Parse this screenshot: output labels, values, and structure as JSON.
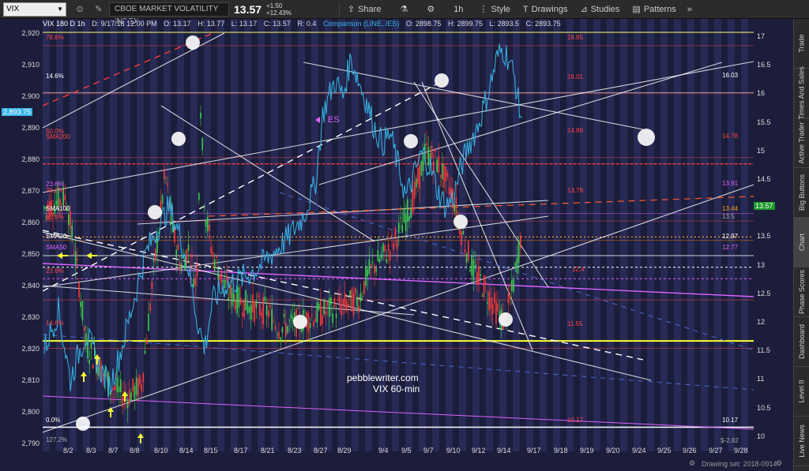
{
  "toolbar": {
    "symbol": "VIX",
    "instrument_name": "CBOE MARKET VOLATILITY INDEX",
    "last_price": "13.57",
    "change": "+1.50",
    "change_pct": "+12.43%",
    "share_label": "Share",
    "interval_label": "1h",
    "style_label": "Style",
    "drawings_label": "Drawings",
    "studies_label": "Studies",
    "patterns_label": "Patterns"
  },
  "infobar": {
    "chart_id": "VIX 180 D 1h",
    "date": "D: 9/17/18 12:00 PM",
    "open": "O: 13.17",
    "high": "H: 13.77",
    "low": "L: 13.17",
    "close": "C: 13.57",
    "range": "R: 0.4",
    "comparison": "Comparison (LINE, /ES)",
    "cmp_open": "O: 2898.75",
    "cmp_high": "H: 2899.75",
    "cmp_low": "L: 2893.5",
    "cmp_close": "C: 2893.75"
  },
  "left_axis": {
    "ticks": [
      "2,920",
      "2,910",
      "2,900",
      "2,890",
      "2,880",
      "2,870",
      "2,860",
      "2,850",
      "2,840",
      "2,830",
      "2,820",
      "2,810",
      "2,800",
      "2,790"
    ],
    "current_label": "2,893.75"
  },
  "right_axis": {
    "ticks": [
      "17",
      "16.5",
      "16",
      "15.5",
      "15",
      "14.5",
      "14",
      "13.5",
      "13",
      "12.5",
      "12",
      "11.5",
      "11",
      "10.5",
      "10"
    ],
    "current_label": "13.57"
  },
  "x_axis": {
    "ticks": [
      "8/2",
      "8/3",
      "8/7",
      "8/8",
      "8/10",
      "8/14",
      "8/15",
      "8/17",
      "8/21",
      "8/23",
      "8/27",
      "8/29",
      "9/4",
      "9/5",
      "9/7",
      "9/10",
      "9/12",
      "9/14",
      "9/17",
      "9/18",
      "9/19",
      "9/20",
      "9/24",
      "9/25",
      "9/26",
      "9/27",
      "9/28"
    ]
  },
  "annotations": {
    "watermark": "pebblewriter.com",
    "subtitle": "VIX 60-min",
    "es_marker": "ES",
    "sma200": "SMA200",
    "sma100": "SMA100",
    "sma20": "SMA20",
    "sma50": "SMA50",
    "fib_top": "78.6%",
    "fib_14_6": "14.6%",
    "fib_50": "50.0%",
    "fib_23_6_upper": "23.6%",
    "fib_38_2": "38.2%",
    "fib_61_8": "61.8%",
    "fib_23_6_lower": "23.6%",
    "fib_14_6_lower": "14.6%",
    "fib_0": "0.0%",
    "fib_bottom": "127.2%",
    "lvl_16_85": "16.85",
    "lvl_16_01": "16.01",
    "lvl_14_89": "14.89",
    "lvl_13_78": "13.78",
    "lvl_12_4": "12.4",
    "lvl_11_55": "11.55",
    "lvl_10_17_red": "10.17",
    "r_16_03": "16.03",
    "r_14_78": "14.78",
    "r_13_91": "13.91",
    "r_13_44": "13.44",
    "r_13_5": "13.5",
    "r_12_97": "12.97",
    "r_12_77": "12.77",
    "r_10_17": "10.17",
    "r_neg": "$-2.82"
  },
  "sidebar": {
    "items": [
      "Trade",
      "Times And Sales",
      "Active Trader",
      "Big Buttons",
      "Chart",
      "Phase Scores",
      "Dashboard",
      "Level II",
      "Live News"
    ]
  },
  "footer": {
    "drawing_set": "Drawing set: 2018-0914"
  },
  "colors": {
    "background": "#1b1d3a",
    "stripe": "#262a55",
    "es_line": "#38b6e8",
    "red": "#ff3b3b",
    "green": "#3bd14d",
    "magenta": "#e062ff",
    "yellow": "#ffff33",
    "fib_red": "#ff4444"
  }
}
